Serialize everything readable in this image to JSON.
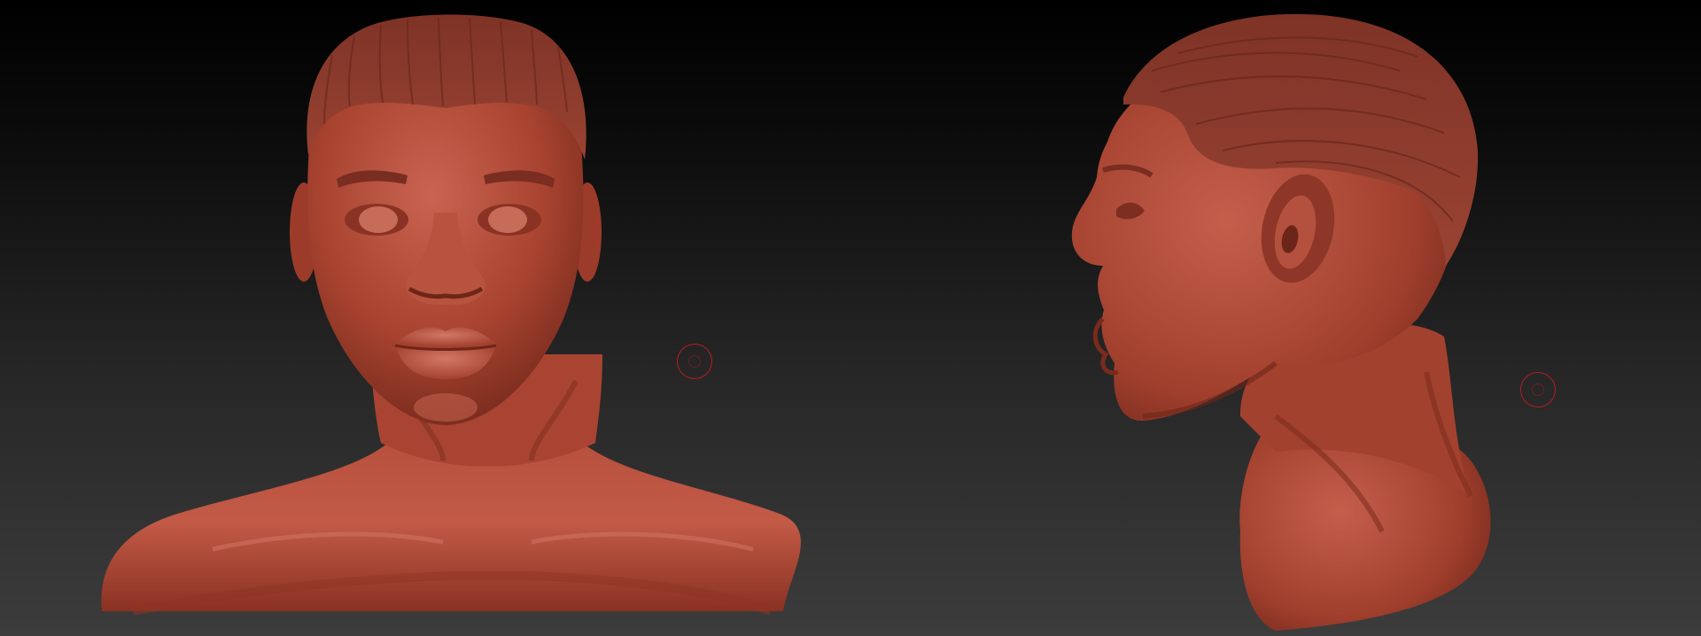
{
  "viewport": {
    "background_top": "#000000",
    "background_bottom": "#3c3c3c"
  },
  "model": {
    "material_color": "#b54a3c",
    "material_shadow": "#5e2018",
    "material_highlight": "#d77e6c",
    "views": [
      "front",
      "side"
    ]
  },
  "brush": {
    "ring_color": "#b41e1e"
  }
}
